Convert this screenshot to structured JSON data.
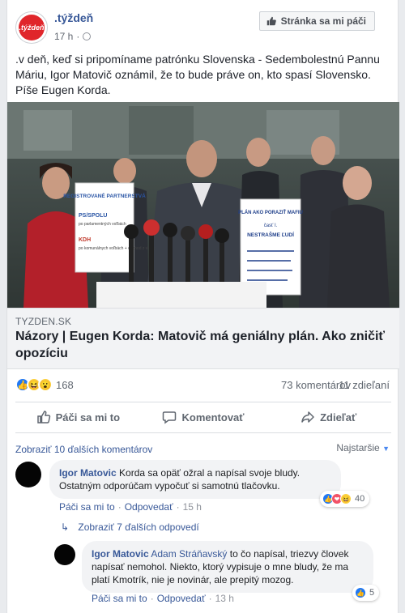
{
  "post": {
    "page_name": ".týždeň",
    "logo_text": ".týždeň",
    "time": "17 h",
    "privacy_icon": "globe-icon",
    "like_page_label": "Stránka sa mi páči",
    "text": ".v deň, keď si pripomíname patrónku Slovenska - Sedembolestnú Pannu Máriu, Igor Matovič oznámil, že to bude práve on, kto spasí Slovensko. Píše Eugen Korda."
  },
  "photo": {
    "sign_left_title": "REGISTROVANÉ PARTNERSTVÁ",
    "sign_left_lines": [
      "PS/SPOLU",
      "po parlamentných voľbách",
      "KDH",
      "po komunálnych voľbách + odchod z vlády"
    ],
    "sign_right_title": "PLÁN AKO PORAZIŤ MAFIU",
    "sign_right_sub": "časť I.",
    "sign_right_main": "NESTRAŠME ĽUDÍ"
  },
  "link": {
    "domain": "TYZDEN.SK",
    "title": "Názory | Eugen Korda: Matovič má geniálny plán. Ako zničiť opozíciu"
  },
  "stats": {
    "reaction_count": "168",
    "comments": "73 komentárov",
    "shares": "11 zdieľaní"
  },
  "actions": {
    "like": "Páči sa mi to",
    "comment": "Komentovať",
    "share": "Zdieľať"
  },
  "comments": {
    "more_label": "Zobraziť 10 ďalších komentárov",
    "sort_label": "Najstaršie",
    "first": {
      "author": "Igor Matovic",
      "text": "Korda sa opäť ožral a napísal svoje bludy. Ostatným odporúčam vypočuť si samotnú tlačovku.",
      "like": "Páči sa mi to",
      "reply": "Odpovedať",
      "time": "15 h",
      "reaction_count": "40"
    },
    "replies_label": "Zobraziť 7 ďalších odpovedí",
    "reply": {
      "author": "Igor Matovic",
      "mention": "Adam Stráňavský",
      "text": "to čo napísal, triezvy človek napísať nemohol. Niekto, ktorý vypisuje o mne bludy, že ma platí Kmotrík, nie je novinár, ale prepitý mozog.",
      "like": "Páči sa mi to",
      "reply": "Odpovedať",
      "time": "13 h",
      "reaction_count": "5"
    }
  },
  "colors": {
    "link_blue": "#385898",
    "like_blue": "#2078f4",
    "brand_red": "#e0262b"
  }
}
